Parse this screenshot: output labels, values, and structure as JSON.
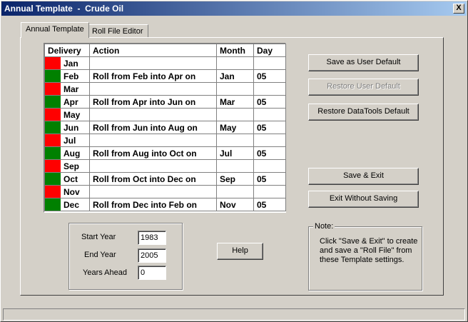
{
  "window": {
    "title": "Annual Template  -  Crude Oil",
    "close_glyph": "X"
  },
  "tabs": [
    {
      "label": "Annual Template",
      "active": true
    },
    {
      "label": "Roll File Editor",
      "active": false
    }
  ],
  "grid": {
    "headers": [
      "Delivery",
      "Action",
      "Month",
      "Day"
    ],
    "rows": [
      {
        "status": "red",
        "delivery": "Jan",
        "action": "",
        "month": "",
        "day": ""
      },
      {
        "status": "green",
        "delivery": "Feb",
        "action": "Roll from Feb into Apr on",
        "month": "Jan",
        "day": "05"
      },
      {
        "status": "red",
        "delivery": "Mar",
        "action": "",
        "month": "",
        "day": ""
      },
      {
        "status": "green",
        "delivery": "Apr",
        "action": "Roll from Apr into Jun on",
        "month": "Mar",
        "day": "05"
      },
      {
        "status": "red",
        "delivery": "May",
        "action": "",
        "month": "",
        "day": ""
      },
      {
        "status": "green",
        "delivery": "Jun",
        "action": "Roll from Jun into Aug on",
        "month": "May",
        "day": "05"
      },
      {
        "status": "red",
        "delivery": "Jul",
        "action": "",
        "month": "",
        "day": ""
      },
      {
        "status": "green",
        "delivery": "Aug",
        "action": "Roll from Aug into Oct on",
        "month": "Jul",
        "day": "05"
      },
      {
        "status": "red",
        "delivery": "Sep",
        "action": "",
        "month": "",
        "day": ""
      },
      {
        "status": "green",
        "delivery": "Oct",
        "action": "Roll from Oct into Dec on",
        "month": "Sep",
        "day": "05"
      },
      {
        "status": "red",
        "delivery": "Nov",
        "action": "",
        "month": "",
        "day": ""
      },
      {
        "status": "green",
        "delivery": "Dec",
        "action": "Roll from Dec into Feb on",
        "month": "Nov",
        "day": "05"
      }
    ]
  },
  "colors": {
    "red": "#ff0000",
    "green": "#008000"
  },
  "buttons": {
    "save_user_default": "Save as User Default",
    "restore_user_default": "Restore User Default",
    "restore_datatools_default": "Restore DataTools Default",
    "save_exit": "Save & Exit",
    "exit_without_saving": "Exit Without Saving",
    "help": "Help"
  },
  "years": {
    "start_label": "Start Year",
    "start_value": "1983",
    "end_label": "End Year",
    "end_value": "2005",
    "ahead_label": "Years Ahead",
    "ahead_value": "0"
  },
  "note": {
    "title": "Note:",
    "text": "Click \"Save & Exit\" to create and save a \"Roll File\" from these Template settings."
  }
}
